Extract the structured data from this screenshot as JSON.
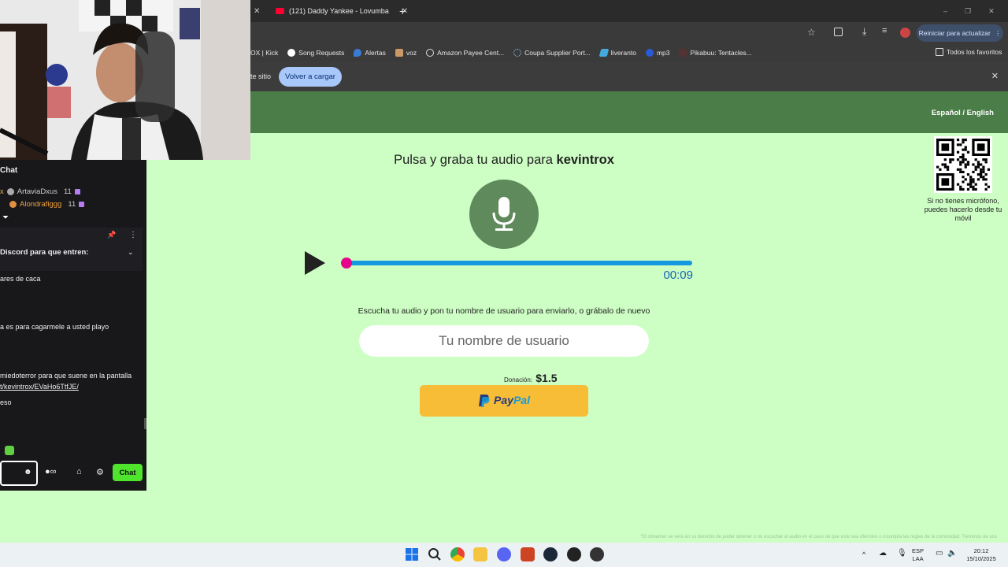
{
  "browser": {
    "tab_title": "(121) Daddy Yankee - Lovumba",
    "update_button": "Reiniciar para actualizar",
    "bookmarks": [
      "OX | Kick",
      "Song Requests",
      "Alertas",
      "voz",
      "Amazon Payee Cent...",
      "Coupa Supplier Port...",
      "liveranto",
      "mp3",
      "Pikabuu: Tentacles..."
    ],
    "all_bookmarks": "Todos los favoritos",
    "infobar_text": "te sitio",
    "reload_button": "Volver a cargar"
  },
  "site": {
    "language_toggle": "Español / English",
    "headline_prefix": "Pulsa y graba tu audio para",
    "streamer": "kevintrox",
    "time": "00:09",
    "playback_progress": 0.0,
    "instruction": "Escucha tu audio y pon tu nombre de usuario para enviarlo, o grábalo de nuevo",
    "username_placeholder": "Tu nombre de usuario",
    "donation_label": "Donación:",
    "donation_amount": "$1.5",
    "paypal_pay": "Pay",
    "paypal_pal": "Pal",
    "qr_note": "Si no tienes micrófono, puedes hacerlo desde tu móvil",
    "footer_note": "*El streamer se verá en su derecho de poder detener o no escuchar el audio en el caso de que este sea ofensivo o incumpla las reglas de la comunidad. Términos de uso"
  },
  "chat": {
    "title": "Chat",
    "users": [
      {
        "name": "ArtaviaDxus",
        "count": "11"
      },
      {
        "name": "Alondrafiggg",
        "count": "11"
      }
    ],
    "pinned_text": "Discord para que entren:",
    "messages": [
      "ares de caca",
      "a es para cagarmele a usted playo",
      "miedoterror para que suene en la pantalla",
      "t/kevintrox/EVaHo6TtfJE/",
      "eso"
    ],
    "send_button": "Chat"
  },
  "taskbar": {
    "lang1": "ESP",
    "lang2": "LAA",
    "time": "20:12",
    "date": "15/10/2025"
  },
  "colors": {
    "page_bg": "#cdfec4",
    "header_green": "#4b7d48",
    "mic_green": "#5f8a5b",
    "progress_blue": "#1498e0",
    "thumb_pink": "#e6058a",
    "paypal_yellow": "#f7bd37",
    "chat_green": "#4fe52d"
  }
}
